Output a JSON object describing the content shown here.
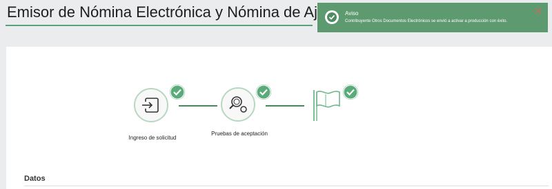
{
  "page": {
    "title": "Emisor de Nómina Electrónica y Nómina de Ajuste"
  },
  "stepper": {
    "steps": [
      {
        "label": "Ingreso de solicitud",
        "icon": "sign-in-icon",
        "status": "completed"
      },
      {
        "label": "Pruebas de aceptación",
        "icon": "magnifier-icon",
        "status": "completed"
      },
      {
        "label": "",
        "icon": "flag-icon",
        "status": "completed"
      }
    ]
  },
  "section": {
    "title": "Datos"
  },
  "toast": {
    "title": "Aviso",
    "message": "Contribuyente Otros Documentos Electrónicos se envió a activar a producción con éxito.",
    "icon": "check-circle-icon",
    "close_icon": "close-icon"
  },
  "colors": {
    "accent": "#5aa17a",
    "badge": "#5aab79",
    "connector": "#3f8d5c",
    "toast_bg": "#5e9a70",
    "page_bg": "#eaecee"
  }
}
